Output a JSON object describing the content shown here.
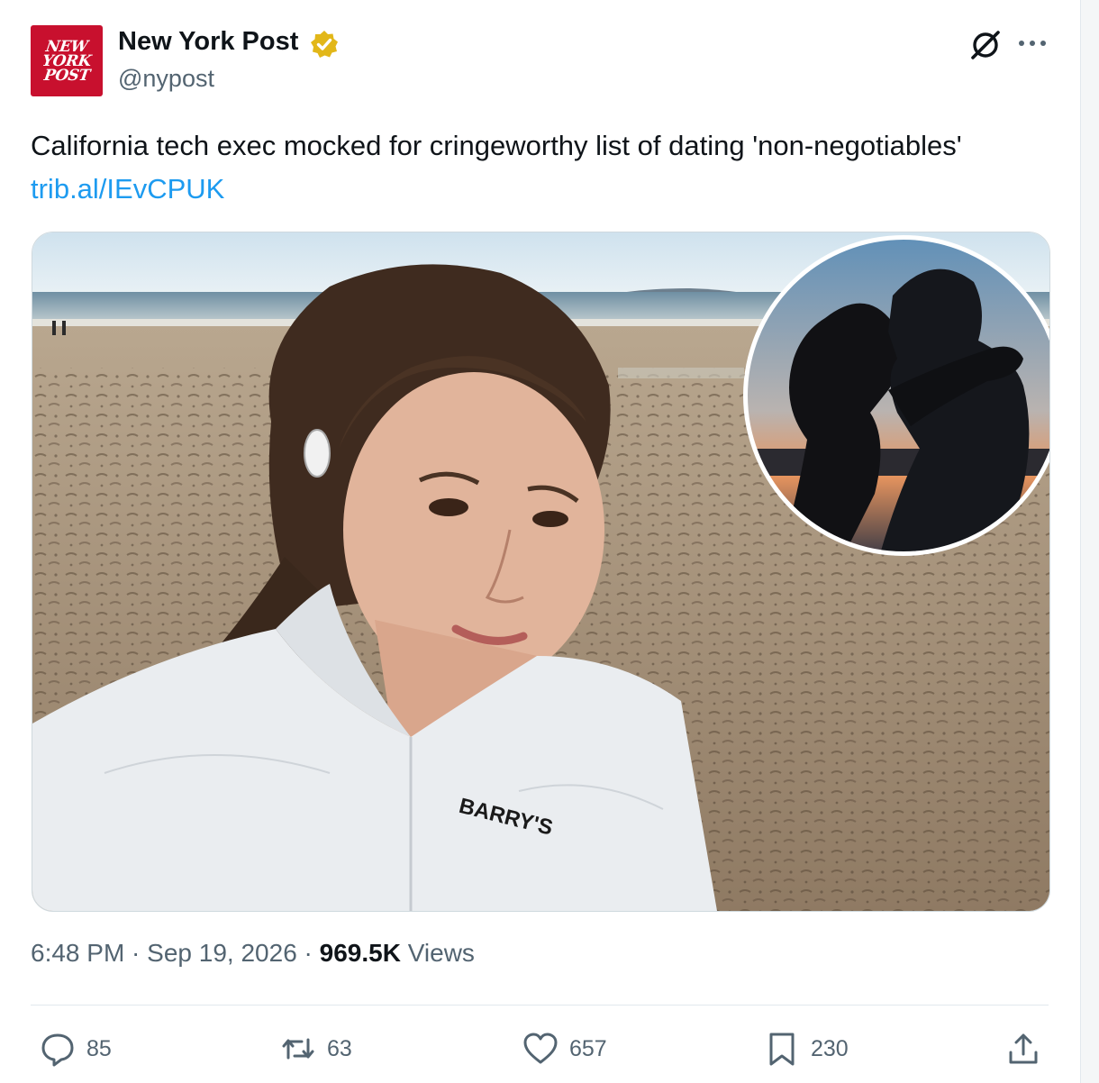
{
  "author": {
    "logo_lines": [
      "NEW",
      "YORK",
      "POST"
    ],
    "name": "New York Post",
    "handle": "@nypost",
    "verified": true
  },
  "tweet": {
    "text": "California tech exec mocked for cringeworthy list of dating 'non-negotiables' ",
    "link": "trib.al/IEvCPUK"
  },
  "media": {
    "shirt_logo": "BARRY'S"
  },
  "meta": {
    "time": "6:48 PM",
    "date": "Sep 19, 2026",
    "views_count": "969.5K",
    "views_label": "Views",
    "sep": " · "
  },
  "actions": {
    "replies": "85",
    "reposts": "63",
    "likes": "657",
    "bookmarks": "230"
  },
  "colors": {
    "accent": "#1d9bf0",
    "verified_gold": "#e2b719",
    "secondary_text": "#536471",
    "brand_red": "#c8102e"
  },
  "icons": [
    "verified-badge-icon",
    "grok-icon",
    "more-icon",
    "reply-icon",
    "repost-icon",
    "like-icon",
    "bookmark-icon",
    "share-icon"
  ]
}
